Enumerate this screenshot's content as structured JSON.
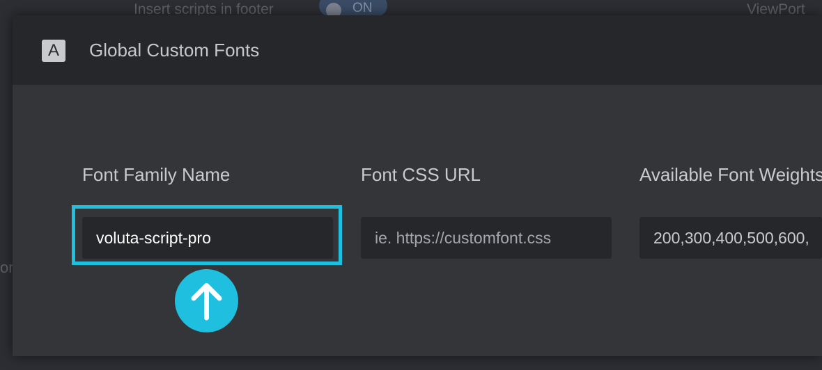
{
  "background": {
    "label_left": "Insert scripts in footer",
    "toggle_text": "ON",
    "label_right": "ViewPort",
    "left_glyph": "or"
  },
  "modal": {
    "icon_letter": "A",
    "title": "Global Custom Fonts",
    "fields": [
      {
        "label": "Font Family Name",
        "value": "voluta-script-pro",
        "placeholder": ""
      },
      {
        "label": "Font CSS URL",
        "value": "",
        "placeholder": "ie. https://customfont.css"
      },
      {
        "label": "Available Font Weights",
        "value": "200,300,400,500,600,",
        "placeholder": ""
      }
    ]
  },
  "annotation": {
    "highlight_color": "#1fbfe0",
    "arrow_icon": "arrow-up-icon"
  }
}
